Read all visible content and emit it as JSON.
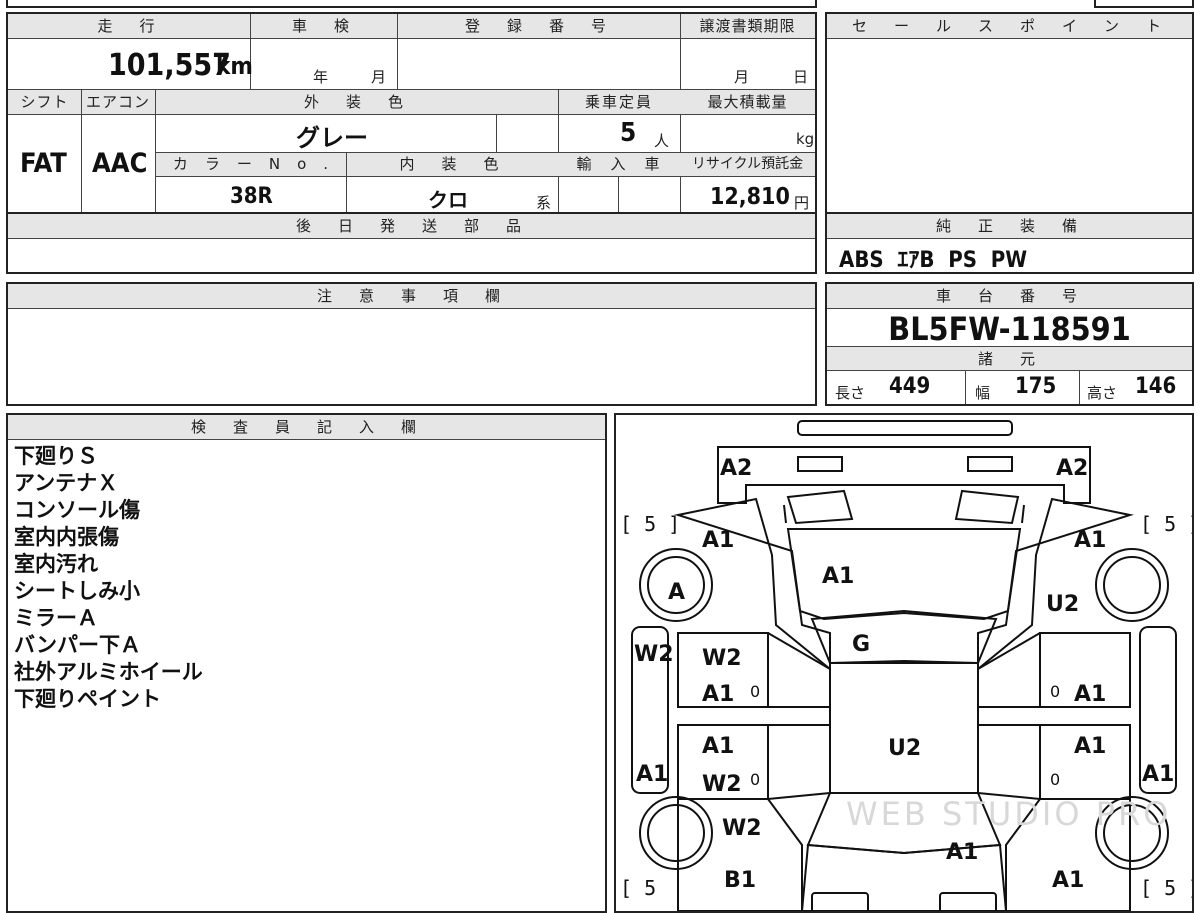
{
  "vehicle": {
    "mileage_label": "走　行",
    "mileage_value": "101,557",
    "mileage_unit": "km",
    "inspection_label": "車　検",
    "inspection_year": "年",
    "inspection_month": "月",
    "registration_label": "登　録　番　号",
    "registration_value": "",
    "transfer_deadline_label": "譲渡書類期限",
    "transfer_month": "月",
    "transfer_day": "日",
    "shift_label": "シフト",
    "shift_value": "FAT",
    "aircon_label": "エアコン",
    "aircon_value": "AAC",
    "exterior_color_label": "外　装　色",
    "exterior_color_value": "グレー",
    "capacity_label": "乗車定員",
    "capacity_value": "5",
    "capacity_unit": "人",
    "max_load_label": "最大積載量",
    "max_load_unit": "kg",
    "color_no_label": "カ　ラ　ー　N　o　.",
    "color_no_value": "38R",
    "interior_color_label": "内　装　色",
    "interior_color_value": "クロ",
    "interior_color_suffix": "系",
    "import_label": "輸　入　車",
    "recycle_label": "リサイクル預託金",
    "recycle_value": "12,810",
    "recycle_unit": "円"
  },
  "sales_point": {
    "label": "セ　ー　ル　ス　ポ　イ　ン　ト"
  },
  "later_parts": {
    "label": "後　日　発　送　部　品"
  },
  "standard_equipment": {
    "label": "純　正　装　備",
    "value": "ABS  ｴｱB  PS  PW"
  },
  "notes": {
    "label": "注　意　事　項　欄"
  },
  "chassis": {
    "label": "車　台　番　号",
    "value": "BL5FW-118591",
    "specs_label": "諸　元",
    "length_label": "長さ",
    "length_value": "449",
    "width_label": "幅",
    "width_value": "175",
    "height_label": "高さ",
    "height_value": "146"
  },
  "inspector": {
    "label": "検　査　員　記　入　欄",
    "lines": [
      "下廻りＳ",
      "アンテナＸ",
      "コンソール傷",
      "室内内張傷",
      "室内汚れ",
      "シートしみ小",
      "ミラーＡ",
      "バンパー下Ａ",
      "社外アルミホイール",
      "下廻りペイント"
    ]
  },
  "diagram": {
    "labels": {
      "front_bumper_left": "A2",
      "front_bumper_right": "A2",
      "fender_front_left": "A1",
      "fender_front_right": "A1",
      "hood": "A1",
      "wheel_front_left": "A",
      "fender_right_extra": "U2",
      "windshield": "G",
      "door_front_left_1": "W2",
      "door_front_left_2": "A1",
      "door_front_right": "A1",
      "sill_left": "W2",
      "roof": "U2",
      "door_rear_left_1": "A1",
      "door_rear_left_2": "W2",
      "door_rear_right": "A1",
      "sill_left_rear": "A1",
      "sill_right_rear": "A1",
      "quarter_rear_left": "W2",
      "trunk": "A1",
      "rear_left": "B1",
      "rear_right": "A1",
      "zero_1": "0",
      "zero_2": "0",
      "zero_3": "0",
      "zero_4": "0",
      "tire_fl": "[ 5 ]",
      "tire_fr": "[ 5 ]",
      "tire_rl": "[ 5",
      "tire_rr": "[ 5 ]"
    },
    "watermark": "WEB STUDIO PRO"
  }
}
